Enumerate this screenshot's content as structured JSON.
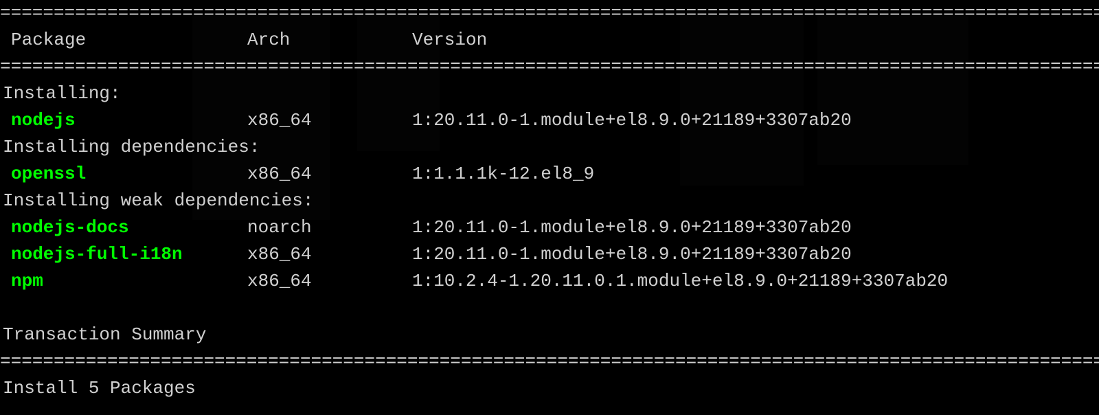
{
  "separator": "=================================================================================================================================================",
  "headers": {
    "package": "Package",
    "arch": "Arch",
    "version": "Version"
  },
  "sections": {
    "installing": "Installing:",
    "installing_deps": "Installing dependencies:",
    "installing_weak_deps": "Installing weak dependencies:"
  },
  "packages": {
    "nodejs": {
      "name": "nodejs",
      "arch": "x86_64",
      "version": "1:20.11.0-1.module+el8.9.0+21189+3307ab20"
    },
    "openssl": {
      "name": "openssl",
      "arch": "x86_64",
      "version": "1:1.1.1k-12.el8_9"
    },
    "nodejs_docs": {
      "name": "nodejs-docs",
      "arch": "noarch",
      "version": "1:20.11.0-1.module+el8.9.0+21189+3307ab20"
    },
    "nodejs_full_i18n": {
      "name": "nodejs-full-i18n",
      "arch": "x86_64",
      "version": "1:20.11.0-1.module+el8.9.0+21189+3307ab20"
    },
    "npm": {
      "name": "npm",
      "arch": "x86_64",
      "version": "1:10.2.4-1.20.11.0.1.module+el8.9.0+21189+3307ab20"
    }
  },
  "summary": {
    "title": "Transaction Summary",
    "install_line": "Install  5 Packages"
  }
}
